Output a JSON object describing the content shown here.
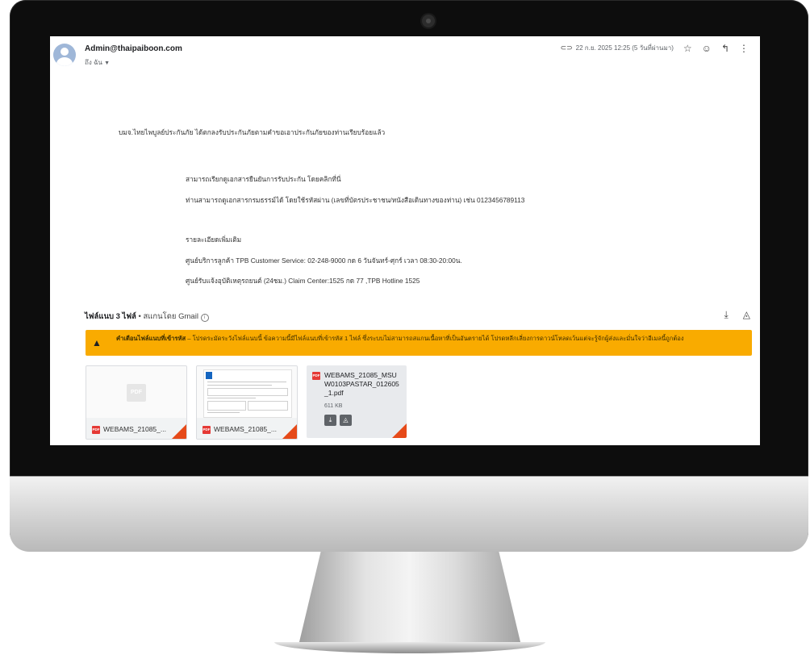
{
  "email": {
    "sender": "Admin@thaipaiboon.com",
    "to_label": "ถึง ฉัน",
    "timestamp": "22 ก.ย. 2025 12:25 (5 วันที่ผ่านมา)"
  },
  "body": {
    "line1": "บมจ.ไทยไพบูลย์ประกันภัย ได้ตกลงรับประกันภัยตามคำขอเอาประกันภัยของท่านเรียบร้อยแล้ว",
    "line2": "สามารถเรียกดูเอกสารยืนยันการรับประกัน โดยคลิกที่นี่",
    "line3": "ท่านสามารถดูเอกสารกรมธรรม์ได้ โดยใช้รหัสผ่าน (เลขที่บัตรประชาชน/หนังสือเดินทางของท่าน) เช่น 0123456789113",
    "line4": "รายละเอียดเพิ่มเติม",
    "line5": "ศูนย์บริการลูกค้า TPB Customer Service: 02-248-9000 กด 6 วันจันทร์-ศุกร์ เวลา 08:30-20:00น.",
    "line6": "ศูนย์รับแจ้งอุบัติเหตุรถยนต์ (24ชม.) Claim Center:1525 กด 77 ,TPB Hotline 1525"
  },
  "attachments": {
    "header_count": "ไฟล์แนบ 3 ไฟล์",
    "header_sub": " • สแกนโดย Gmail",
    "warning_title": "คำเตือนไฟล์แนบที่เข้ารหัส",
    "warning_text": " – โปรดระมัดระวังไฟล์แนบนี้ ข้อความนี้มีไฟล์แนบที่เข้ารหัส 1 ไฟล์ ซึ่งระบบไม่สามารถสแกนเนื้อหาที่เป็นอันตรายได้ โปรดหลีกเลี่ยงการดาวน์โหลดเว้นแต่จะรู้จักผู้ส่งและมั่นใจว่าอีเมลนี้ถูกต้อง",
    "files": [
      {
        "name": "WEBAMS_21085_..."
      },
      {
        "name": "WEBAMS_21085_..."
      },
      {
        "name": "WEBAMS_21085_MSUW0103PASTAR_012605_1.pdf",
        "size": "611 KB"
      }
    ],
    "pdf_badge": "PDF"
  },
  "icons": {
    "label": "label-icon",
    "star": "star-icon",
    "emoji": "emoji-icon",
    "reply": "reply-icon",
    "more": "more-vert-icon",
    "download_all": "download-icon",
    "drive": "add-to-drive-icon",
    "warning": "warning-icon"
  }
}
